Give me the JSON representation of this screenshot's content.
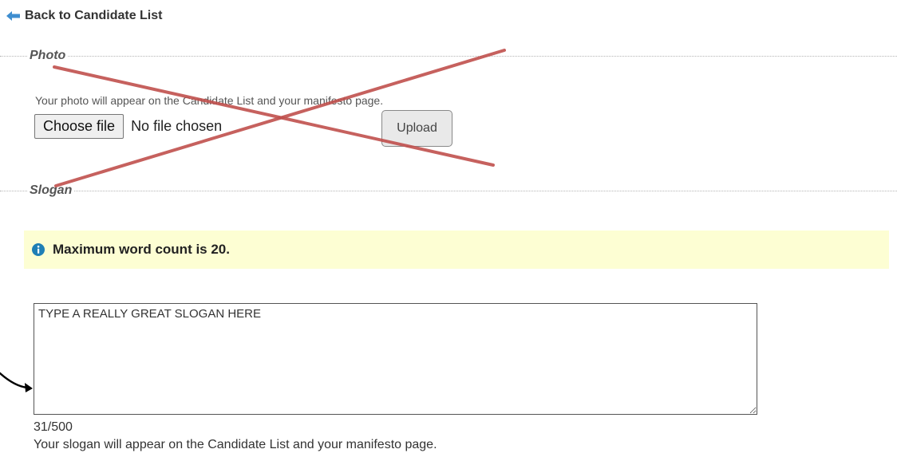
{
  "nav": {
    "back_label": "Back to Candidate List"
  },
  "photo": {
    "legend": "Photo",
    "help_text": "Your photo will appear on the Candidate List and your manifesto page.",
    "choose_file_label": "Choose file",
    "no_file_text": "No file chosen",
    "upload_label": "Upload"
  },
  "slogan": {
    "legend": "Slogan",
    "info_icon": "info-circle-icon",
    "info_text": "Maximum word count is 20.",
    "value": "TYPE A REALLY GREAT SLOGAN HERE",
    "char_count": "31/500",
    "help_text": "Your slogan will appear on the Candidate List and your manifesto page."
  },
  "colors": {
    "info_background": "#fdfed3",
    "info_icon": "#1f7fb5",
    "back_arrow": "#3e8ed0",
    "cross_annotation": "#c0504d",
    "pointer_arrow": "#000000"
  },
  "icons": {
    "back": "back-arrow-icon",
    "info": "info-circle-icon",
    "cross": "red-cross-annotation",
    "pointer": "pointer-arrow-annotation"
  }
}
